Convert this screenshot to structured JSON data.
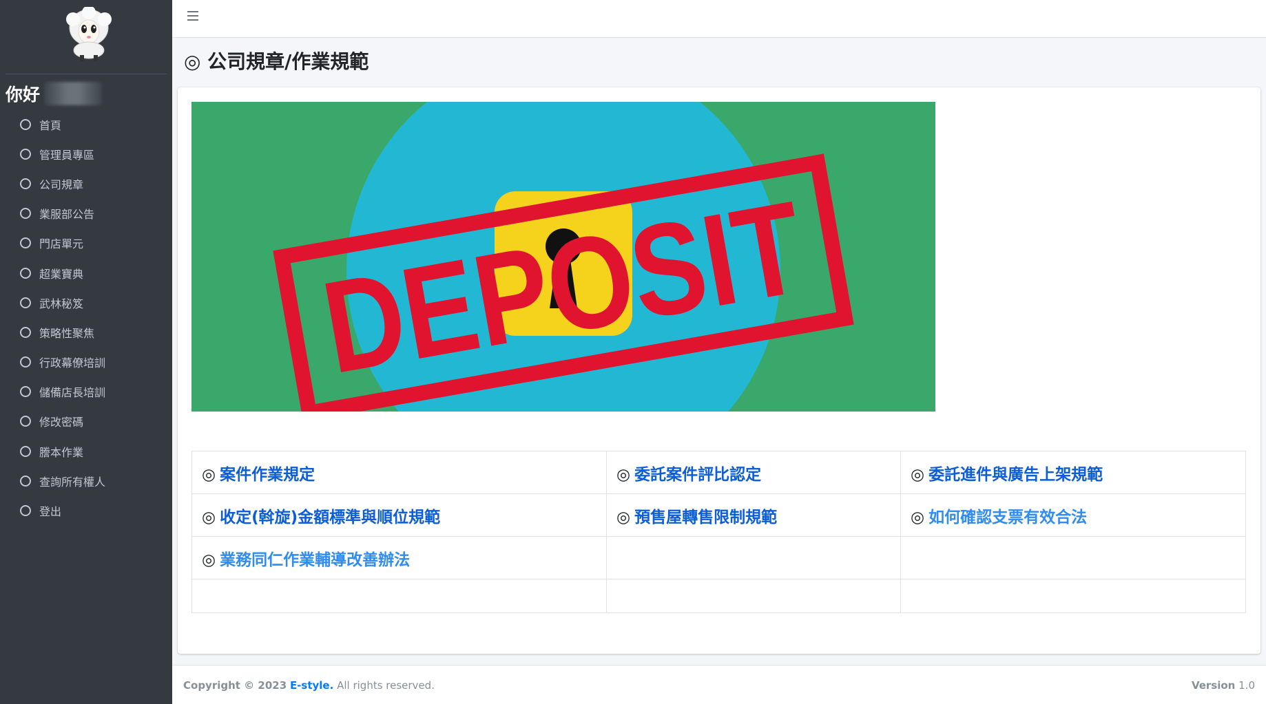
{
  "sidebar": {
    "greeting": "你好",
    "items": [
      {
        "label": "首頁"
      },
      {
        "label": "管理員專區"
      },
      {
        "label": "公司規章"
      },
      {
        "label": "業服部公告"
      },
      {
        "label": "門店單元"
      },
      {
        "label": "超業寶典"
      },
      {
        "label": "武林秘笈"
      },
      {
        "label": "策略性聚焦"
      },
      {
        "label": "行政幕僚培訓"
      },
      {
        "label": "儲備店長培訓"
      },
      {
        "label": "修改密碼"
      },
      {
        "label": "謄本作業"
      },
      {
        "label": "查詢所有權人"
      },
      {
        "label": "登出"
      }
    ]
  },
  "header": {
    "title": "◎ 公司規章/作業規範"
  },
  "banner": {
    "text": "DEPOSIT"
  },
  "links": {
    "mark": "◎",
    "r0c0": "案件作業規定",
    "r0c1": "委託案件評比認定",
    "r0c2": "委託進件與廣告上架規範",
    "r1c0": "收定(斡旋)金額標準與順位規範",
    "r1c1": "預售屋轉售限制規範",
    "r1c2": "如何確認支票有效合法",
    "r2c0": "業務同仁作業輔導改善辦法"
  },
  "footer": {
    "copyright": "Copyright © 2023",
    "brand": "E-style.",
    "rights": "All rights reserved.",
    "version_label": "Version",
    "version": "1.0"
  },
  "colors": {
    "sidebar_bg": "#343a40",
    "link": "#0b5ed7",
    "banner_green": "#3aa86b",
    "banner_blue": "#22b8d4",
    "banner_red": "#e0142f",
    "banner_yellow": "#f5d21c"
  }
}
